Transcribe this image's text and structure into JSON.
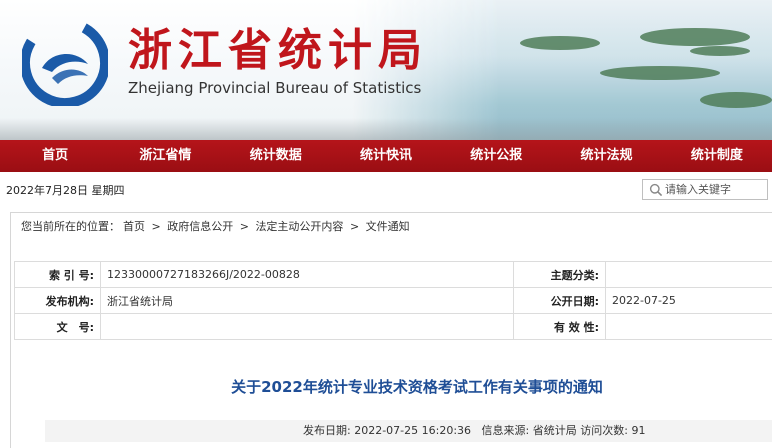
{
  "header": {
    "title_cn": "浙江省统计局",
    "title_en": "Zhejiang Provincial Bureau of Statistics",
    "logo_icon": "zjstats-logo-icon",
    "brand_red": "#c0161c",
    "brand_blue": "#1a5aa8"
  },
  "nav": {
    "items": [
      "首页",
      "浙江省情",
      "统计数据",
      "统计快讯",
      "统计公报",
      "统计法规",
      "统计制度"
    ]
  },
  "datebar": {
    "date": "2022年7月28日",
    "weekday": "星期四"
  },
  "search": {
    "placeholder": "请输入关键字",
    "icon": "search-icon"
  },
  "breadcrumb": {
    "prefix": "您当前所在的位置：",
    "items": [
      "首页",
      "政府信息公开",
      "法定主动公开内容",
      "文件通知"
    ],
    "separator": ">"
  },
  "info": {
    "index_label": "索 引 号:",
    "index_value": "12330000727183266J/2022-00828",
    "topic_label": "主题分类:",
    "topic_value": "",
    "issuer_label": "发布机构:",
    "issuer_value": "浙江省统计局",
    "pubdate_label": "公开日期:",
    "pubdate_value": "2022-07-25",
    "docno_label": "文　号:",
    "docno_value": "",
    "validity_label": "有 效 性:",
    "validity_value": ""
  },
  "article": {
    "title": "关于2022年统计专业技术资格考试工作有关事项的通知",
    "meta_date_label": "发布日期:",
    "meta_date_value": "2022-07-25 16:20:36",
    "meta_source_label": "信息来源:",
    "meta_source_value": "省统计局",
    "meta_views_label": "访问次数:",
    "meta_views_value": "91"
  }
}
